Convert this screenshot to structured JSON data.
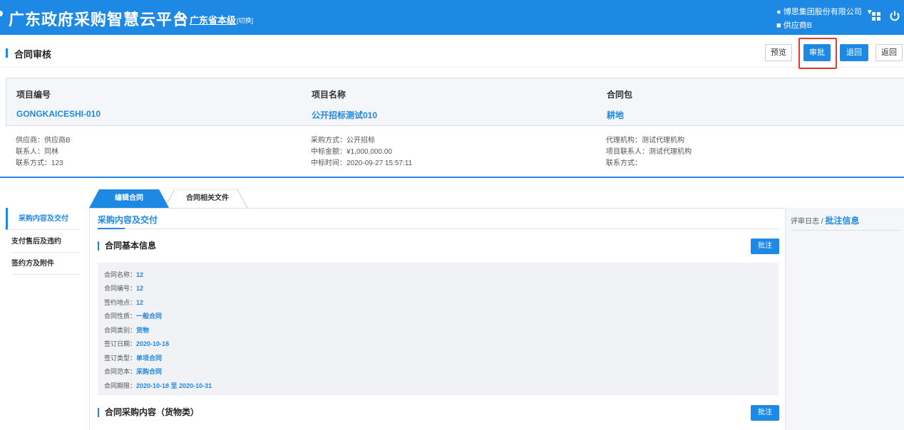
{
  "header": {
    "app_title": "广东政府采购智慧云平台",
    "region": "广东省本级",
    "switch_label": "[切换]",
    "org_name": "博思集团股份有限公司",
    "role": "供应商B"
  },
  "page": {
    "title": "合同审核",
    "buttons": {
      "preview": "预览",
      "approve": "审批",
      "return_back": "退回",
      "go_back": "返回"
    }
  },
  "project": {
    "code_label": "项目编号",
    "code_value": "GONGKAICESHI-010",
    "name_label": "项目名称",
    "name_value": "公开招标测试010",
    "package_label": "合同包",
    "package_value": "耕地"
  },
  "details": {
    "col1": [
      "供应商：供应商B",
      "联系人：同林",
      "联系方式：123"
    ],
    "col2": [
      "采购方式：公开招标",
      "中标金额：¥1,000,000.00",
      "中标时间：2020-09-27 15:57:11"
    ],
    "col3": [
      "代理机构：测试代理机构",
      "项目联系人：测试代理机构",
      "联系方式："
    ]
  },
  "tabs": [
    {
      "label": "编辑合同"
    },
    {
      "label": "合同相关文件"
    }
  ],
  "left_nav": [
    {
      "label": "采购内容及交付"
    },
    {
      "label": "支付售后及违约"
    },
    {
      "label": "签约方及附件"
    }
  ],
  "main": {
    "section_title": "采购内容及交付",
    "basic_info_title": "合同基本信息",
    "note_button": "批注",
    "basic_info": [
      {
        "label": "合同名称：",
        "value": "12"
      },
      {
        "label": "合同编号：",
        "value": "12"
      },
      {
        "label": "签约地点：",
        "value": "12"
      },
      {
        "label": "合同性质：",
        "value": "一般合同"
      },
      {
        "label": "合同类别：",
        "value": "货物"
      },
      {
        "label": "签订日期：",
        "value": "2020-10-18"
      },
      {
        "label": "签订类型：",
        "value": "单项合同"
      },
      {
        "label": "合同范本：",
        "value": "采购合同"
      },
      {
        "label": "合同期限：",
        "value": "2020-10-18 至 2020-10-31"
      }
    ],
    "purchase_title": "合同采购内容（货物类）"
  },
  "right_panel": {
    "log_label": "评审日志 /",
    "notes_label": "批注信息"
  },
  "colors": {
    "primary": "#1e88e5",
    "highlight": "#e53935"
  }
}
